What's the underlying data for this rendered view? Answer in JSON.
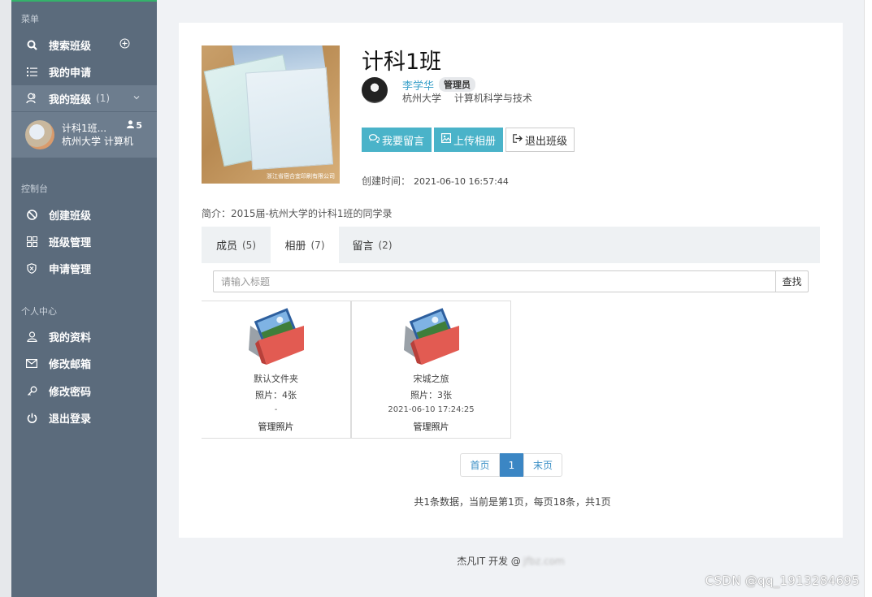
{
  "sidebar": {
    "menu_title": "菜单",
    "items_menu": [
      {
        "label": "搜索班级"
      },
      {
        "label": "我的申请"
      },
      {
        "label": "我的班级",
        "count": "(1)"
      }
    ],
    "class_entry": {
      "name": "计科1班...",
      "members": "5",
      "school": "杭州大学  计算机"
    },
    "console_title": "控制台",
    "items_console": [
      {
        "label": "创建班级"
      },
      {
        "label": "班级管理"
      },
      {
        "label": "申请管理"
      }
    ],
    "personal_title": "个人中心",
    "items_personal": [
      {
        "label": "我的资料"
      },
      {
        "label": "修改邮箱"
      },
      {
        "label": "修改密码"
      },
      {
        "label": "退出登录"
      }
    ]
  },
  "class_info": {
    "title": "计科1班",
    "owner_name": "李学华",
    "owner_badge": "管理员",
    "owner_school": "杭州大学",
    "owner_major": "计算机科学与技术",
    "cover_watermark": "浙江省宿合宜印刷有限公司",
    "created_label": "创建时间：",
    "created_time": "2021-06-10 16:57:44",
    "intro": "简介：2015届-杭州大学的计科1班的同学录"
  },
  "actions": {
    "message": "我要留言",
    "upload": "上传相册",
    "exit": "退出班级"
  },
  "tabs": [
    {
      "label": "成员",
      "count": "(5)"
    },
    {
      "label": "相册",
      "count": "(7)"
    },
    {
      "label": "留言",
      "count": "(2)"
    }
  ],
  "search": {
    "placeholder": "请输入标题",
    "button": "查找"
  },
  "albums": [
    {
      "name": "默认文件夹",
      "photos": "照片：4张",
      "date": "-",
      "manage": "管理照片"
    },
    {
      "name": "宋城之旅",
      "photos": "照片：3张",
      "date": "2021-06-10 17:24:25",
      "manage": "管理照片"
    }
  ],
  "pagination": {
    "first": "首页",
    "current": "1",
    "last": "末页",
    "info": "共1条数据，当前是第1页，每页18条，共1页"
  },
  "footer": {
    "text": "杰凡IT 开发 @",
    "blurred": "jfbz.com"
  },
  "watermark": "CSDN @qq_1913284695",
  "colors": {
    "sidebar": "#5b6b7c",
    "accent": "#4ab3c9",
    "page_active": "#3b86c4",
    "link": "#3b8fc6"
  }
}
